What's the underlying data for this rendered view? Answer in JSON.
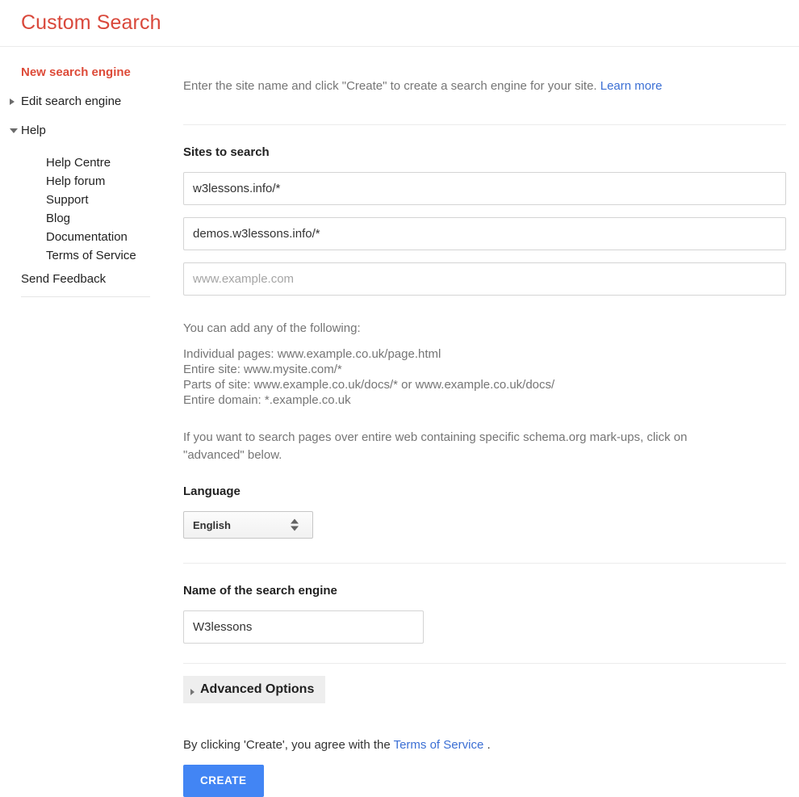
{
  "header": {
    "title": "Custom Search",
    "title_color": "#d9483b"
  },
  "sidebar": {
    "primary_items": [
      {
        "label": "New search engine",
        "marker": "none",
        "active": true
      },
      {
        "label": "Edit search engine",
        "marker": "triangle-right-icon",
        "active": false
      },
      {
        "label": "Help",
        "marker": "triangle-down-icon",
        "active": false
      }
    ],
    "help_sub_items": [
      {
        "label": "Help Centre"
      },
      {
        "label": "Help forum"
      },
      {
        "label": "Support"
      },
      {
        "label": "Blog"
      },
      {
        "label": "Documentation"
      },
      {
        "label": "Terms of Service"
      }
    ],
    "send_feedback": "Send Feedback",
    "active_color": "#dd4b39"
  },
  "main": {
    "intro": {
      "text": "Enter the site name and click \"Create\" to create a search engine for your site.",
      "learn_more": "Learn more"
    },
    "sites_section": {
      "title": "Sites to search",
      "inputs": [
        {
          "value": "w3lessons.info/*",
          "placeholder": "www.example.com"
        },
        {
          "value": "demos.w3lessons.info/*",
          "placeholder": "www.example.com"
        },
        {
          "value": "",
          "placeholder": "www.example.com"
        }
      ],
      "hint_lead": "You can add any of the following:",
      "hint_lines": [
        "Individual pages: www.example.co.uk/page.html",
        "Entire site: www.mysite.com/*",
        "Parts of site: www.example.co.uk/docs/* or www.example.co.uk/docs/",
        "Entire domain: *.example.co.uk"
      ],
      "schema_note": "If you want to search pages over entire web containing specific schema.org mark-ups, click on \"advanced\" below."
    },
    "language_section": {
      "title": "Language",
      "selected": "English",
      "options": [
        "English"
      ]
    },
    "name_section": {
      "title": "Name of the search engine",
      "value": "W3lessons",
      "placeholder": ""
    },
    "advanced_options": {
      "label": "Advanced Options",
      "marker": "triangle-right-icon"
    },
    "footer": {
      "agree_prefix": "By clicking 'Create', you agree with the",
      "terms_link": "Terms of Service",
      "agree_suffix": ".",
      "create_label": "CREATE",
      "create_color": "#4285f4"
    }
  }
}
